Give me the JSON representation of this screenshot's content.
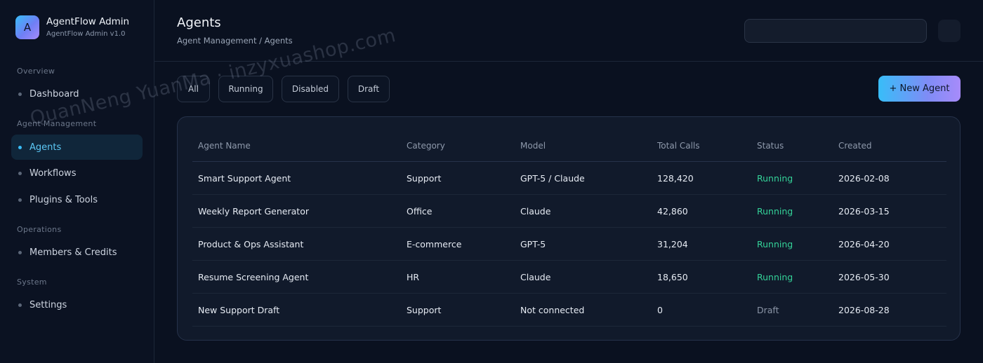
{
  "brand": {
    "logo_letter": "A",
    "title": "AgentFlow Admin",
    "subtitle": "AgentFlow Admin v1.0"
  },
  "sidebar": {
    "sections": [
      {
        "title": "Overview",
        "items": [
          {
            "label": "Dashboard",
            "active": false
          }
        ]
      },
      {
        "title": "Agent Management",
        "items": [
          {
            "label": "Agents",
            "active": true
          },
          {
            "label": "Workflows",
            "active": false
          },
          {
            "label": "Plugins & Tools",
            "active": false
          }
        ]
      },
      {
        "title": "Operations",
        "items": [
          {
            "label": "Members & Credits",
            "active": false
          }
        ]
      },
      {
        "title": "System",
        "items": [
          {
            "label": "Settings",
            "active": false
          }
        ]
      }
    ]
  },
  "header": {
    "title": "Agents",
    "breadcrumb": "Agent Management / Agents",
    "search_value": ""
  },
  "filters": [
    "All",
    "Running",
    "Disabled",
    "Draft"
  ],
  "new_agent_label": "+ New Agent",
  "table": {
    "columns": [
      "Agent Name",
      "Category",
      "Model",
      "Total Calls",
      "Status",
      "Created"
    ],
    "rows": [
      {
        "name": "Smart Support Agent",
        "category": "Support",
        "model": "GPT-5 / Claude",
        "calls": "128,420",
        "status": "Running",
        "created": "2026-02-08"
      },
      {
        "name": "Weekly Report Generator",
        "category": "Office",
        "model": "Claude",
        "calls": "42,860",
        "status": "Running",
        "created": "2026-03-15"
      },
      {
        "name": "Product & Ops Assistant",
        "category": "E-commerce",
        "model": "GPT-5",
        "calls": "31,204",
        "status": "Running",
        "created": "2026-04-20"
      },
      {
        "name": "Resume Screening Agent",
        "category": "HR",
        "model": "Claude",
        "calls": "18,650",
        "status": "Running",
        "created": "2026-05-30"
      },
      {
        "name": "New Support Draft",
        "category": "Support",
        "model": "Not connected",
        "calls": "0",
        "status": "Draft",
        "created": "2026-08-28"
      }
    ]
  },
  "colors": {
    "accent": "#38bdf8",
    "running": "#34d399",
    "draft": "#8b95a6",
    "background": "#0a1120"
  },
  "watermark": "QuanNeng YuanMa · inzyxuashop.com"
}
